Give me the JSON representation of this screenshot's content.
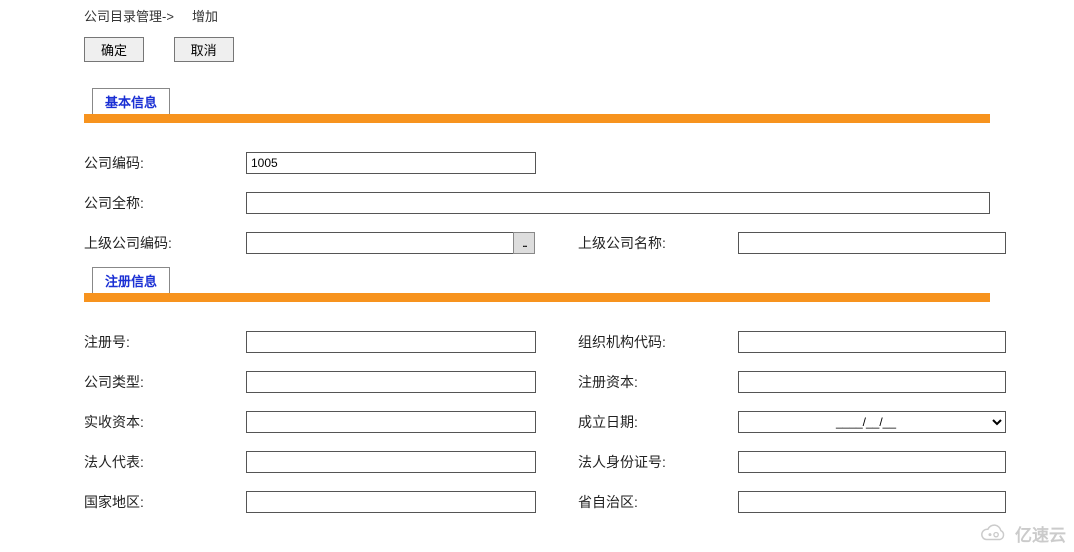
{
  "breadcrumb": {
    "path": "公司目录管理->",
    "action": "增加"
  },
  "toolbar": {
    "ok": "确定",
    "cancel": "取消"
  },
  "sections": {
    "basic": {
      "title": "基本信息",
      "rows": {
        "code": {
          "label": "公司编码:",
          "value": "1005"
        },
        "fullname": {
          "label": "公司全称:",
          "value": ""
        },
        "parent_code": {
          "label": "上级公司编码:",
          "value": "",
          "lookup": "..."
        },
        "parent_name": {
          "label": "上级公司名称:",
          "value": ""
        }
      }
    },
    "reg": {
      "title": "注册信息",
      "rows": {
        "reg_no": {
          "label": "注册号:",
          "value": ""
        },
        "org_code": {
          "label": "组织机构代码:",
          "value": ""
        },
        "company_type": {
          "label": "公司类型:",
          "value": ""
        },
        "reg_capital": {
          "label": "注册资本:",
          "value": ""
        },
        "paid_capital": {
          "label": "实收资本:",
          "value": ""
        },
        "est_date": {
          "label": "成立日期:",
          "value": "____/__/__"
        },
        "legal_rep": {
          "label": "法人代表:",
          "value": ""
        },
        "legal_id": {
          "label": "法人身份证号:",
          "value": ""
        },
        "country": {
          "label": "国家地区:",
          "value": ""
        },
        "province": {
          "label": "省自治区:",
          "value": ""
        }
      }
    }
  },
  "watermark": {
    "text": "亿速云"
  }
}
